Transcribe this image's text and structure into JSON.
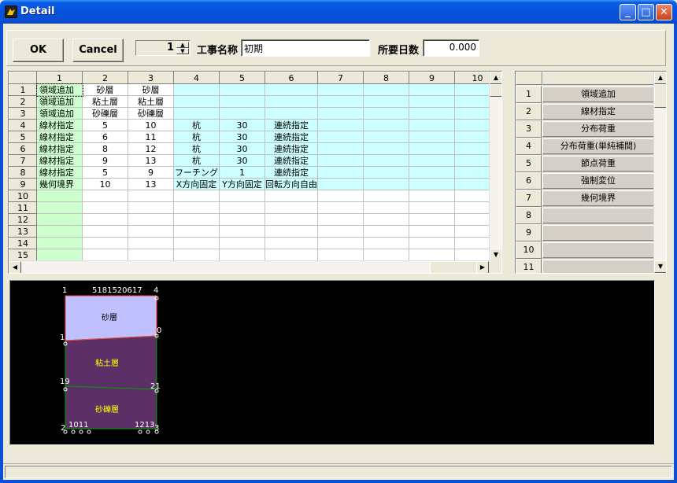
{
  "window": {
    "title": "Detail",
    "controls": [
      "minimize",
      "maximize",
      "close"
    ]
  },
  "toolbar": {
    "ok_label": "OK",
    "cancel_label": "Cancel",
    "spin_value": "1",
    "project_name_label": "工事名称",
    "project_name_value": "初期",
    "duration_label": "所要日数",
    "duration_value": "0.000"
  },
  "grid": {
    "columns": [
      "1",
      "2",
      "3",
      "4",
      "5",
      "6",
      "7",
      "8",
      "9",
      "10"
    ],
    "rows": [
      {
        "num": "1",
        "cells": [
          "領域追加",
          "砂層",
          "砂層",
          "",
          "",
          "",
          "",
          "",
          "",
          ""
        ]
      },
      {
        "num": "2",
        "cells": [
          "領域追加",
          "粘土層",
          "粘土層",
          "",
          "",
          "",
          "",
          "",
          "",
          ""
        ]
      },
      {
        "num": "3",
        "cells": [
          "領域追加",
          "砂礫層",
          "砂礫層",
          "",
          "",
          "",
          "",
          "",
          "",
          ""
        ]
      },
      {
        "num": "4",
        "cells": [
          "線材指定",
          "5",
          "10",
          "杭",
          "30",
          "連続指定",
          "",
          "",
          "",
          ""
        ]
      },
      {
        "num": "5",
        "cells": [
          "線材指定",
          "6",
          "11",
          "杭",
          "30",
          "連続指定",
          "",
          "",
          "",
          ""
        ]
      },
      {
        "num": "6",
        "cells": [
          "線材指定",
          "8",
          "12",
          "杭",
          "30",
          "連続指定",
          "",
          "",
          "",
          ""
        ]
      },
      {
        "num": "7",
        "cells": [
          "線材指定",
          "9",
          "13",
          "杭",
          "30",
          "連続指定",
          "",
          "",
          "",
          ""
        ]
      },
      {
        "num": "8",
        "cells": [
          "線材指定",
          "5",
          "9",
          "フーチング",
          "1",
          "連続指定",
          "",
          "",
          "",
          ""
        ]
      },
      {
        "num": "9",
        "cells": [
          "幾何境界",
          "10",
          "13",
          "X方向固定",
          "Y方向固定",
          "回転方向自由",
          "",
          "",
          "",
          ""
        ]
      },
      {
        "num": "10",
        "cells": [
          "",
          "",
          "",
          "",
          "",
          "",
          "",
          "",
          "",
          ""
        ]
      },
      {
        "num": "11",
        "cells": [
          "",
          "",
          "",
          "",
          "",
          "",
          "",
          "",
          "",
          ""
        ]
      },
      {
        "num": "12",
        "cells": [
          "",
          "",
          "",
          "",
          "",
          "",
          "",
          "",
          "",
          ""
        ]
      },
      {
        "num": "13",
        "cells": [
          "",
          "",
          "",
          "",
          "",
          "",
          "",
          "",
          "",
          ""
        ]
      },
      {
        "num": "14",
        "cells": [
          "",
          "",
          "",
          "",
          "",
          "",
          "",
          "",
          "",
          ""
        ]
      },
      {
        "num": "15",
        "cells": [
          "",
          "",
          "",
          "",
          "",
          "",
          "",
          "",
          "",
          ""
        ]
      }
    ]
  },
  "commands": {
    "items": [
      {
        "num": "1",
        "label": "領域追加"
      },
      {
        "num": "2",
        "label": "線材指定"
      },
      {
        "num": "3",
        "label": "分布荷重"
      },
      {
        "num": "4",
        "label": "分布荷重(単純補間)"
      },
      {
        "num": "5",
        "label": "節点荷重"
      },
      {
        "num": "6",
        "label": "強制変位"
      },
      {
        "num": "7",
        "label": "幾何境界"
      },
      {
        "num": "8",
        "label": ""
      },
      {
        "num": "9",
        "label": ""
      },
      {
        "num": "10",
        "label": ""
      },
      {
        "num": "11",
        "label": ""
      }
    ]
  },
  "canvas": {
    "layers": [
      {
        "name": "砂層",
        "fill": "#c0c0ff",
        "text_color": "#000000"
      },
      {
        "name": "粘土層",
        "fill": "#5c3066",
        "text_color": "#ffff00"
      },
      {
        "name": "砂礫層",
        "fill": "#5c3066",
        "text_color": "#ffff00"
      }
    ],
    "node_labels": {
      "top_left": "1",
      "top_mid": "5181520617",
      "top_right": "4",
      "left_mid1": "1",
      "right_mid1": "0",
      "left_mid2": "19",
      "right_mid2": "21",
      "bottom_left": "2",
      "bottom_mid1": "1011",
      "bottom_mid2": "1213",
      "bottom_right": "3"
    }
  },
  "colors": {
    "grid_highlight": "#ccffff",
    "grid_first_col": "#ccffcc",
    "canvas_bg": "#000000"
  }
}
